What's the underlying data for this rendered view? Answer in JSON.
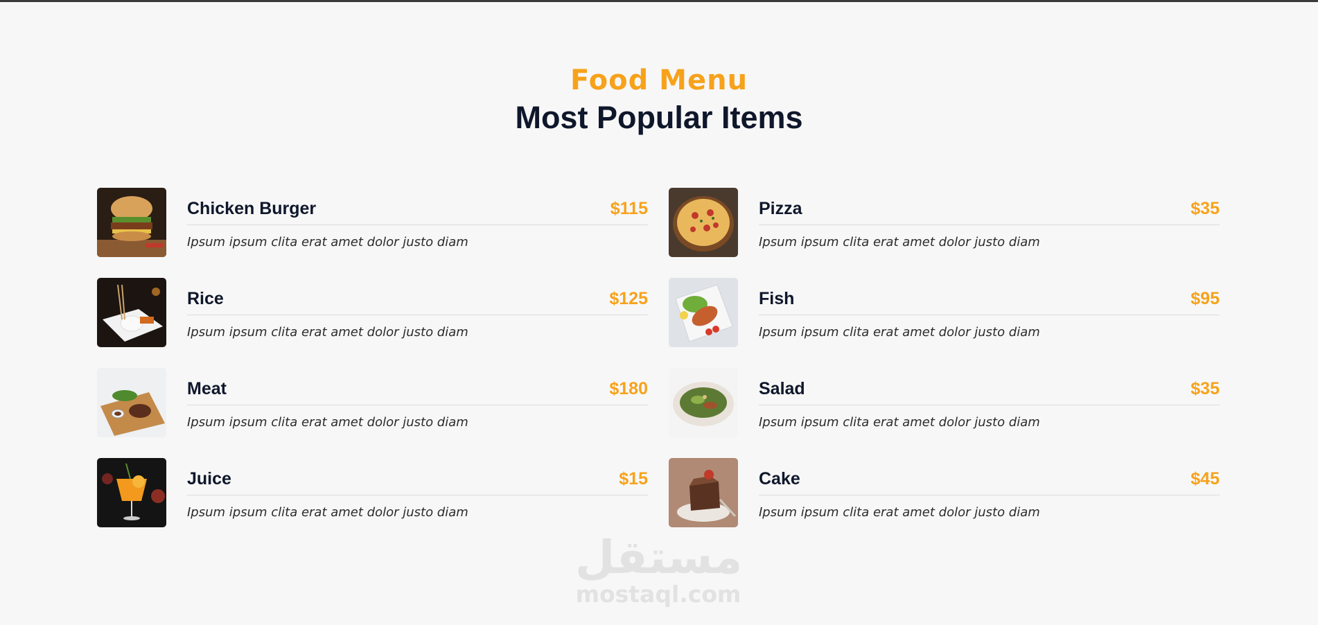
{
  "header": {
    "subtitle": "Food Menu",
    "title": "Most Popular Items"
  },
  "items": [
    {
      "name": "Chicken Burger",
      "price": "$115",
      "description": "Ipsum ipsum clita erat amet dolor justo diam",
      "image_icon": "burger-image"
    },
    {
      "name": "Pizza",
      "price": "$35",
      "description": "Ipsum ipsum clita erat amet dolor justo diam",
      "image_icon": "pizza-image"
    },
    {
      "name": "Rice",
      "price": "$125",
      "description": "Ipsum ipsum clita erat amet dolor justo diam",
      "image_icon": "rice-image"
    },
    {
      "name": "Fish",
      "price": "$95",
      "description": "Ipsum ipsum clita erat amet dolor justo diam",
      "image_icon": "fish-image"
    },
    {
      "name": "Meat",
      "price": "$180",
      "description": "Ipsum ipsum clita erat amet dolor justo diam",
      "image_icon": "meat-image"
    },
    {
      "name": "Salad",
      "price": "$35",
      "description": "Ipsum ipsum clita erat amet dolor justo diam",
      "image_icon": "salad-image"
    },
    {
      "name": "Juice",
      "price": "$15",
      "description": "Ipsum ipsum clita erat amet dolor justo diam",
      "image_icon": "juice-image"
    },
    {
      "name": "Cake",
      "price": "$45",
      "description": "Ipsum ipsum clita erat amet dolor justo diam",
      "image_icon": "cake-image"
    }
  ],
  "watermark": {
    "arabic": "مستقل",
    "latin": "mostaql.com"
  },
  "colors": {
    "accent": "#f7a21b",
    "dark": "#0f172b",
    "background": "#f7f7f7"
  }
}
